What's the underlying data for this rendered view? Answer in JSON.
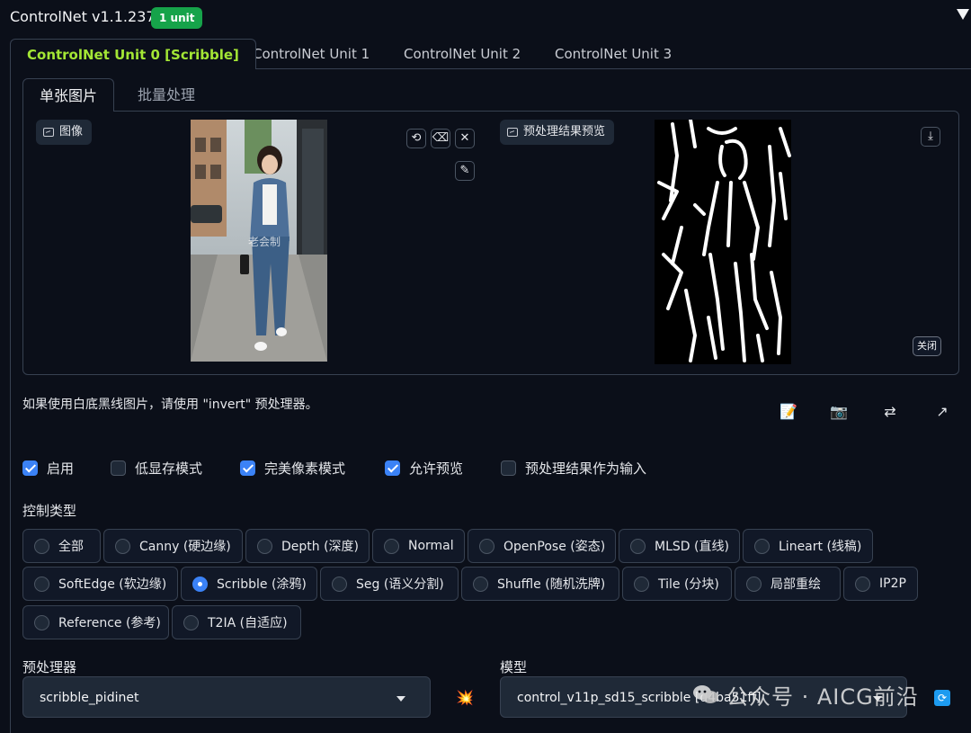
{
  "header": {
    "title": "ControlNet v1.1.237",
    "badge": "1 unit"
  },
  "unit_tabs": [
    "ControlNet Unit 0 [Scribble]",
    "ControlNet Unit 1",
    "ControlNet Unit 2",
    "ControlNet Unit 3"
  ],
  "inner_tabs": [
    "单张图片",
    "批量处理"
  ],
  "image_panel": {
    "input_label": "图像",
    "preview_label": "预处理结果预览",
    "close_label": "关闭",
    "photo_watermark": "老会制"
  },
  "hint": "如果使用白底黑线图片，请使用 \"invert\" 预处理器。",
  "checkboxes": [
    {
      "label": "启用",
      "checked": true
    },
    {
      "label": "低显存模式",
      "checked": false
    },
    {
      "label": "完美像素模式",
      "checked": true
    },
    {
      "label": "允许预览",
      "checked": true
    },
    {
      "label": "预处理结果作为输入",
      "checked": false
    }
  ],
  "control_type_label": "控制类型",
  "control_types": [
    [
      "全部",
      "Canny (硬边缘)",
      "Depth (深度)",
      "Normal",
      "OpenPose (姿态)",
      "MLSD (直线)",
      "Lineart (线稿)"
    ],
    [
      "SoftEdge (软边缘)",
      "Scribble (涂鸦)",
      "Seg (语义分割)",
      "Shuffle (随机洗牌)",
      "Tile (分块)",
      "局部重绘",
      "IP2P"
    ],
    [
      "Reference (参考)",
      "T2IA (自适应)"
    ]
  ],
  "selected_control_type": "Scribble (涂鸦)",
  "preprocessor": {
    "label": "预处理器",
    "value": "scribble_pidinet"
  },
  "model": {
    "label": "模型",
    "value": "control_v11p_sd15_scribble [d4ba51ff]"
  },
  "watermark": "公众号 · AICG前沿",
  "colors": {
    "accent": "#3b82f6",
    "active_tab": "#a3e635",
    "badge": "#16a34a",
    "background": "#0b0f19"
  }
}
